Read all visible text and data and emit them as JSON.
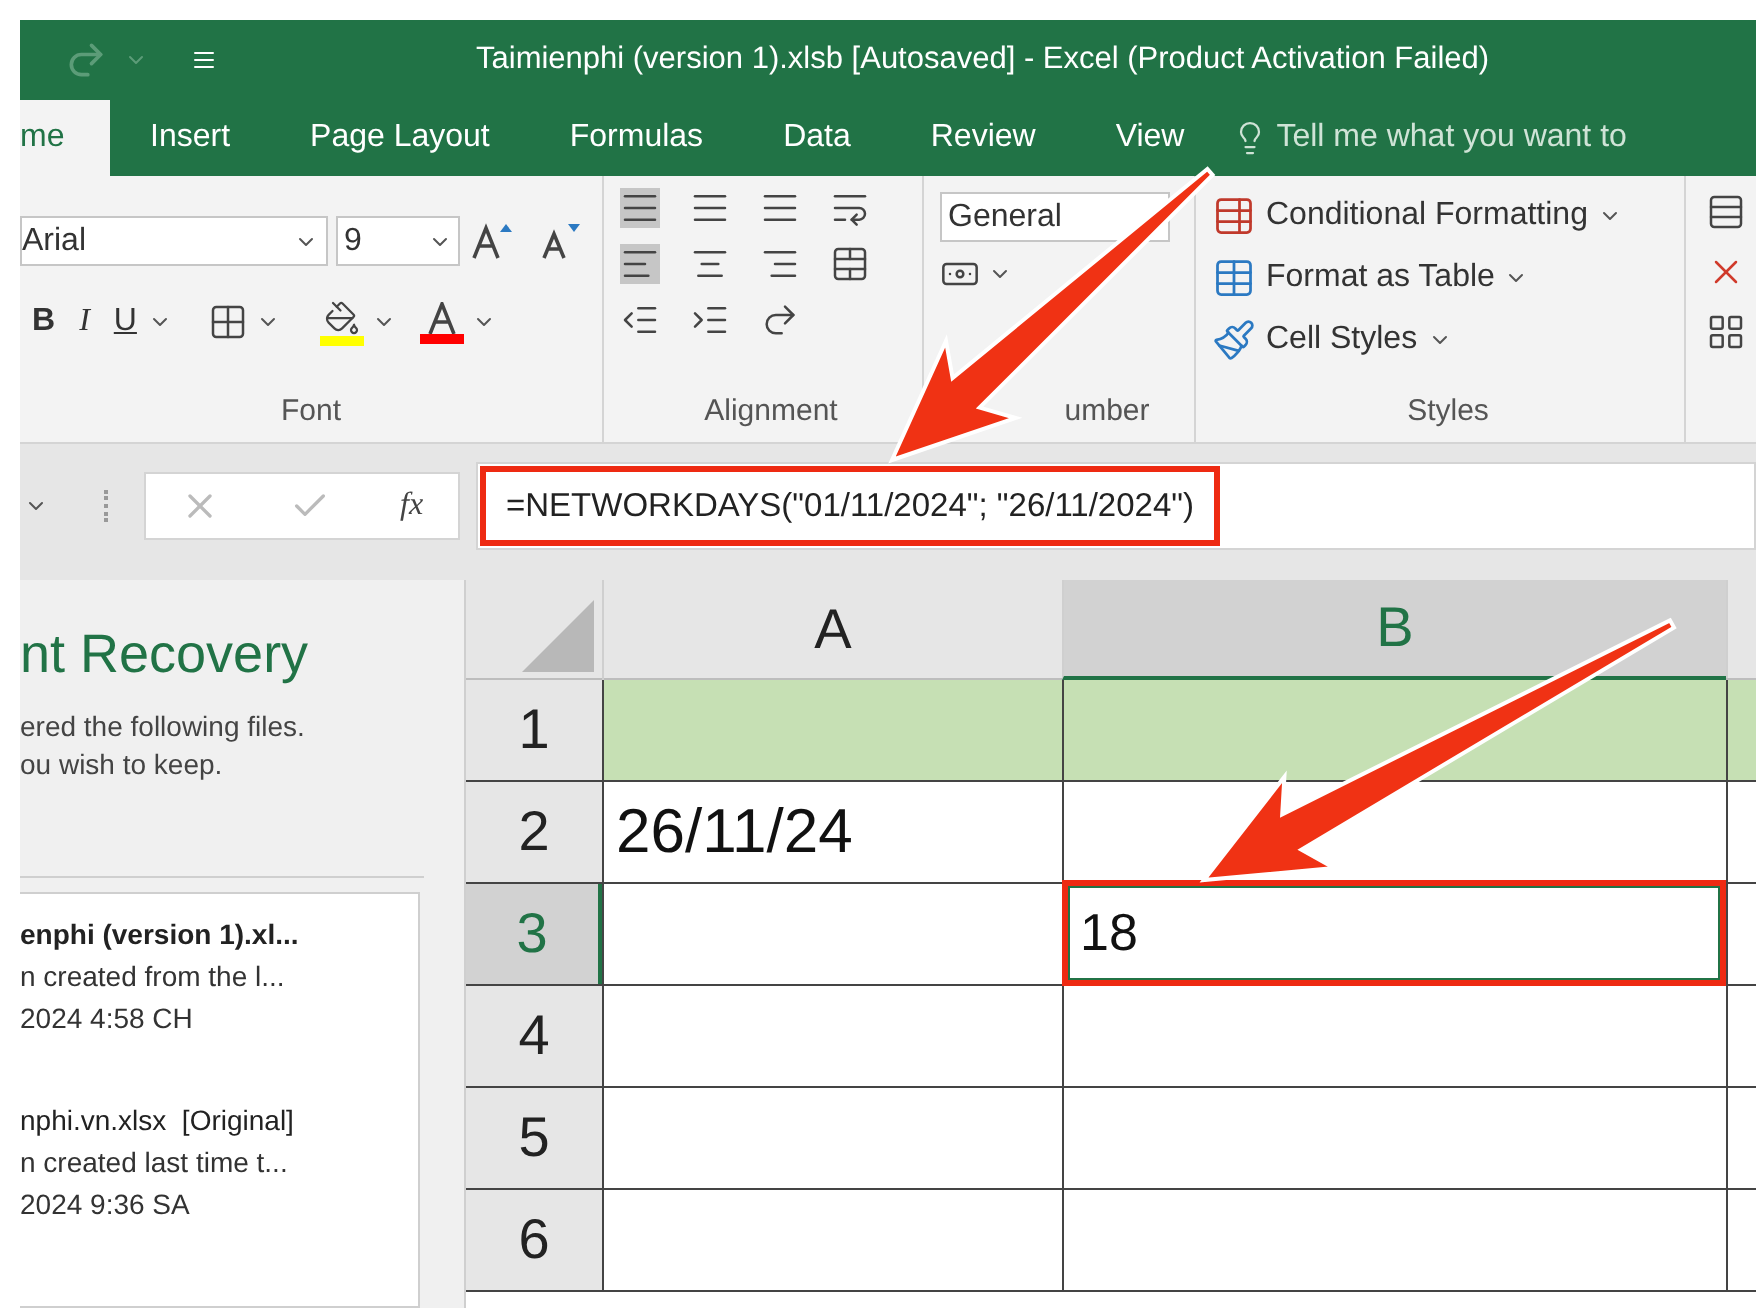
{
  "window": {
    "title": "Taimienphi (version 1).xlsb [Autosaved] - Excel (Product Activation Failed)"
  },
  "tabs": [
    {
      "label": "me",
      "selected": true
    },
    {
      "label": "Insert",
      "selected": false
    },
    {
      "label": "Page Layout",
      "selected": false
    },
    {
      "label": "Formulas",
      "selected": false
    },
    {
      "label": "Data",
      "selected": false
    },
    {
      "label": "Review",
      "selected": false
    },
    {
      "label": "View",
      "selected": false
    }
  ],
  "tell_me": {
    "placeholder": "Tell me what you want to"
  },
  "ribbon": {
    "font": {
      "name": "Arial",
      "size": "9",
      "bold": "B",
      "italic": "I",
      "underline": "U",
      "label": "Font"
    },
    "alignment": {
      "label": "Alignment"
    },
    "number": {
      "format": "General",
      "label": "umber"
    },
    "styles": {
      "items": [
        "Conditional Formatting",
        "Format as Table",
        "Cell Styles"
      ],
      "label": "Styles"
    }
  },
  "formula_bar": {
    "fx": "fx",
    "formula": "=NETWORKDAYS(\"01/11/2024\"; \"26/11/2024\")"
  },
  "recovery": {
    "title": "nt Recovery",
    "lines": [
      "ered the following files.",
      "ou wish to keep."
    ],
    "files": [
      {
        "name": "enphi (version 1).xl...",
        "note": "n created from the l...",
        "time": "2024 4:58 CH",
        "bold": true
      },
      {
        "name": "nphi.vn.xlsx  [Original]",
        "note": "n created last time t...",
        "time": "2024 9:36 SA",
        "bold": false
      }
    ]
  },
  "sheet": {
    "columns": [
      {
        "label": "A",
        "selected": false
      },
      {
        "label": "B",
        "selected": true
      }
    ],
    "rows": [
      {
        "header": "1",
        "selected": false,
        "shaded": true
      },
      {
        "header": "2",
        "selected": false,
        "shaded": false,
        "column_a": "26/11/24"
      },
      {
        "header": "3",
        "selected": true,
        "shaded": false,
        "column_b": "18"
      },
      {
        "header": "4",
        "selected": false,
        "shaded": false
      },
      {
        "header": "5",
        "selected": false,
        "shaded": false
      },
      {
        "header": "6",
        "selected": false,
        "shaded": false
      }
    ]
  }
}
